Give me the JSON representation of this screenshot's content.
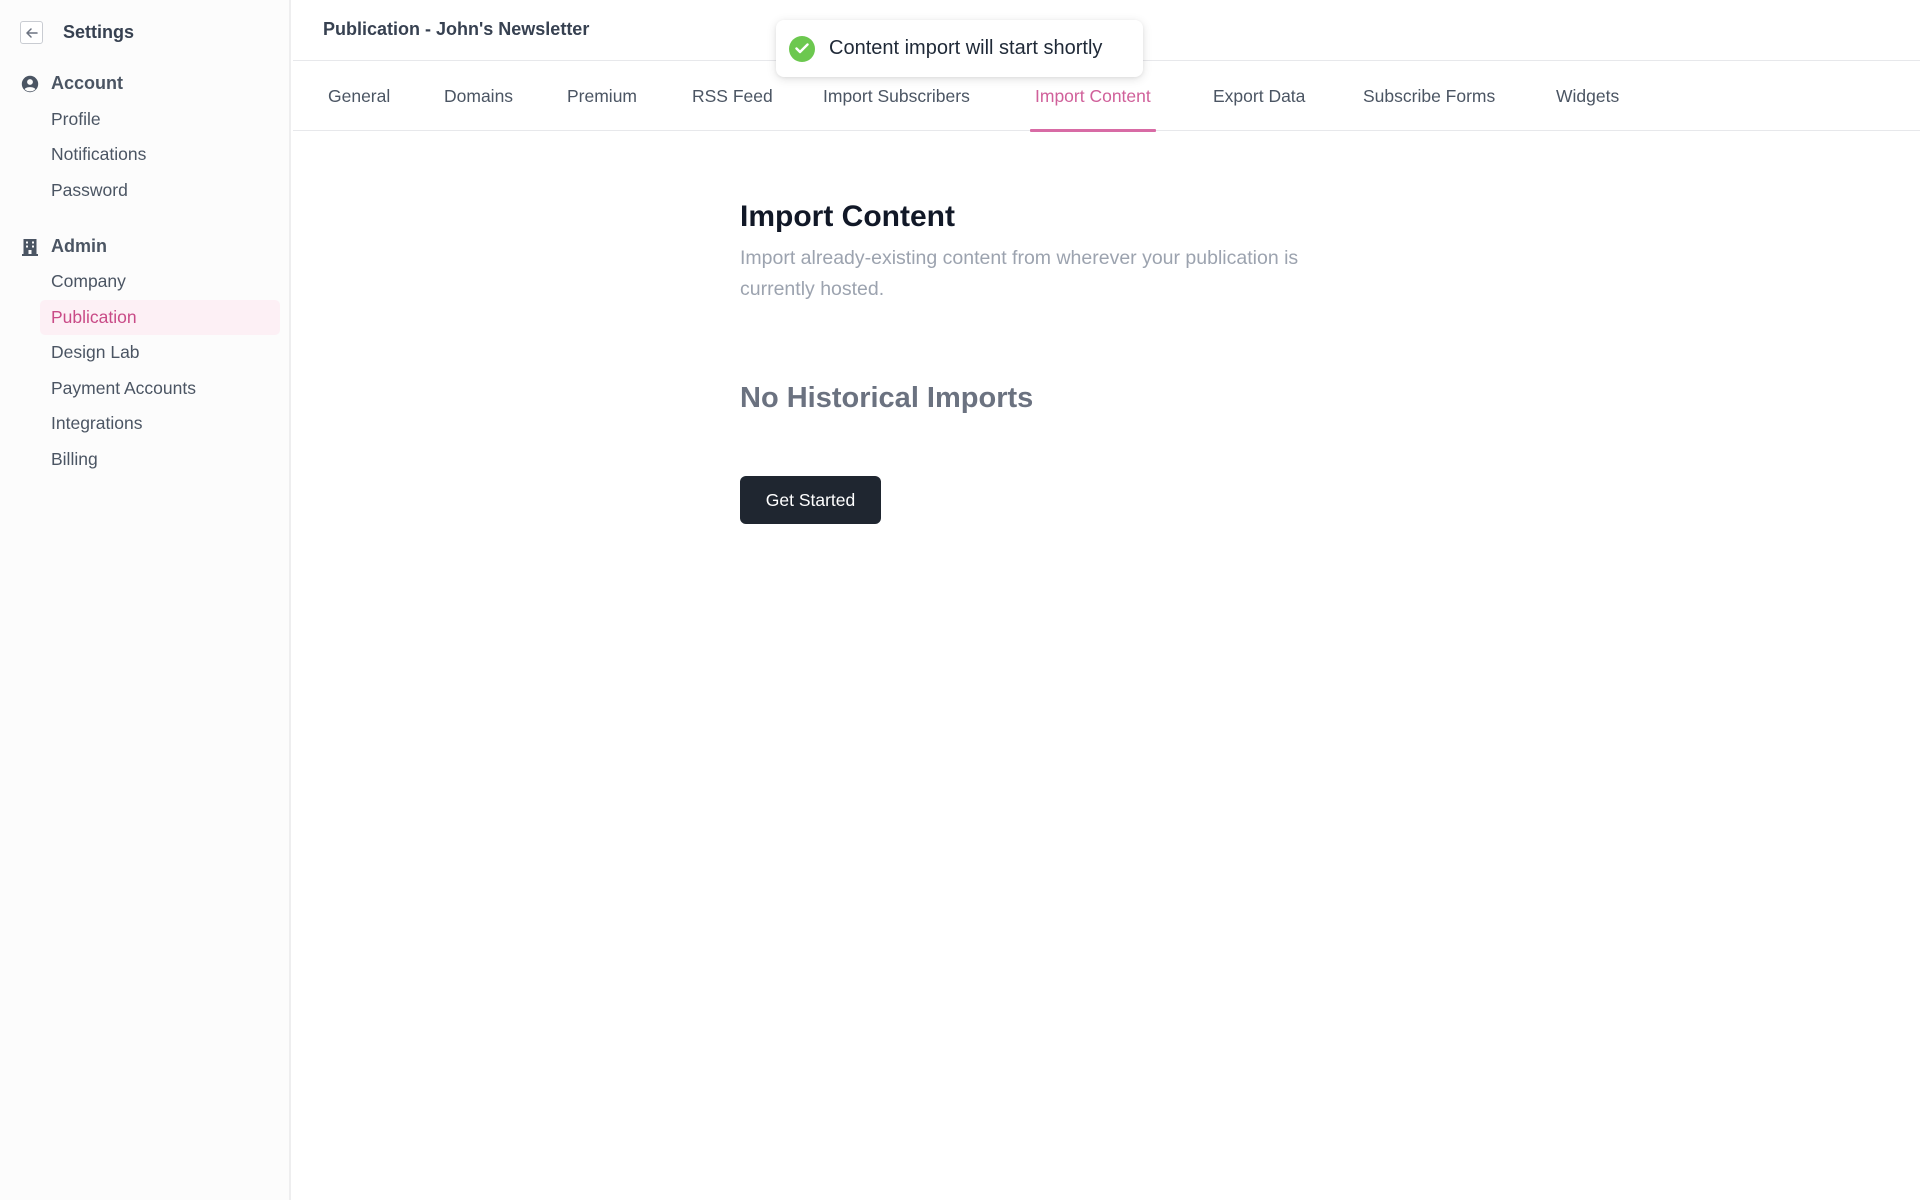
{
  "sidebar": {
    "title": "Settings",
    "sections": [
      {
        "label": "Account",
        "icon": "user-circle-icon",
        "items": [
          "Profile",
          "Notifications",
          "Password"
        ]
      },
      {
        "label": "Admin",
        "icon": "building-icon",
        "items": [
          "Company",
          "Publication",
          "Design Lab",
          "Payment Accounts",
          "Integrations",
          "Billing"
        ]
      }
    ],
    "active_item": "Publication"
  },
  "header": {
    "title": "Publication - John's Newsletter"
  },
  "toast": {
    "message": "Content import will start shortly",
    "icon": "check-circle-icon",
    "color": "#6cc84f"
  },
  "tabs": [
    {
      "label": "General"
    },
    {
      "label": "Domains"
    },
    {
      "label": "Premium"
    },
    {
      "label": "RSS Feed"
    },
    {
      "label": "Import Subscribers"
    },
    {
      "label": "Import Content",
      "active": true
    },
    {
      "label": "Export Data"
    },
    {
      "label": "Subscribe Forms"
    },
    {
      "label": "Widgets"
    }
  ],
  "main": {
    "title": "Import Content",
    "description": "Import already-existing content from wherever your publication is currently hosted.",
    "empty_state": "No Historical Imports",
    "button_label": "Get Started"
  },
  "colors": {
    "accent": "#d0609a",
    "active_bg": "#fdf0f5",
    "button_bg": "#1f2630",
    "success": "#6cc84f"
  }
}
